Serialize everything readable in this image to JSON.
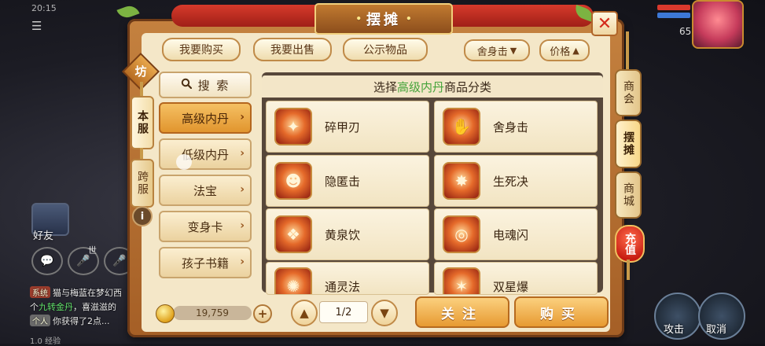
{
  "status_bar": {
    "time": "20:15"
  },
  "header": {
    "title": "摆摊"
  },
  "top_tabs": [
    {
      "label": "我要购买"
    },
    {
      "label": "我要出售"
    },
    {
      "label": "公示物品"
    }
  ],
  "sort_buttons": [
    {
      "label": "舍身击",
      "arrow": "▼"
    },
    {
      "label": "价格",
      "arrow": "▲"
    }
  ],
  "left_badge": "坊",
  "left_tabs": [
    {
      "label": "本服",
      "active": true
    },
    {
      "label": "跨服",
      "active": false
    }
  ],
  "info_icon": "i",
  "search_button": {
    "label": "搜 索"
  },
  "categories": [
    {
      "label": "高级内丹",
      "active": true
    },
    {
      "label": "低级内丹",
      "active": false
    },
    {
      "label": "法宝",
      "active": false
    },
    {
      "label": "变身卡",
      "active": false
    },
    {
      "label": "孩子书籍",
      "active": false
    }
  ],
  "grid_header": {
    "prefix": "选择",
    "highlight": "高级内丹",
    "suffix": "商品分类"
  },
  "items": [
    {
      "label": "碎甲刃",
      "icon": "blade-icon"
    },
    {
      "label": "舍身击",
      "icon": "claw-icon"
    },
    {
      "label": "隐匿击",
      "icon": "mask-icon"
    },
    {
      "label": "生死决",
      "icon": "spark-icon"
    },
    {
      "label": "黄泉饮",
      "icon": "beast-icon"
    },
    {
      "label": "电魂闪",
      "icon": "swirl-icon"
    },
    {
      "label": "通灵法",
      "icon": "spirit-icon"
    },
    {
      "label": "双星爆",
      "icon": "star-icon"
    }
  ],
  "money": {
    "amount": "19,759",
    "plus": "+"
  },
  "pagination": {
    "current": "1/2",
    "prev": "▲",
    "next": "▼"
  },
  "actions": {
    "follow": "关注",
    "buy": "购买"
  },
  "right_tabs": [
    {
      "label": "商会",
      "active": false
    },
    {
      "label": "摆摊",
      "active": true
    },
    {
      "label": "商城",
      "active": false
    }
  ],
  "recharge": {
    "label": "充值"
  },
  "background": {
    "friend_label": "好友",
    "level": "65",
    "chat_world": "世",
    "chat_lines": [
      {
        "tag": "系统",
        "text": "猫与梅蓝在梦幻西"
      },
      {
        "tag": "",
        "text_pre": "个",
        "highlight": "九转金丹",
        "text_post": "，喜滋滋的"
      },
      {
        "tag": "个人",
        "text": "你获得了2点..."
      }
    ],
    "attack_label": "攻击",
    "cancel_label": "取消",
    "bottom_tag": "1.0 经验"
  },
  "colors": {
    "accent": "#e1952e",
    "frame": "#b06a2c",
    "highlight_green": "#45a33a",
    "close_red": "#d42a1c"
  }
}
